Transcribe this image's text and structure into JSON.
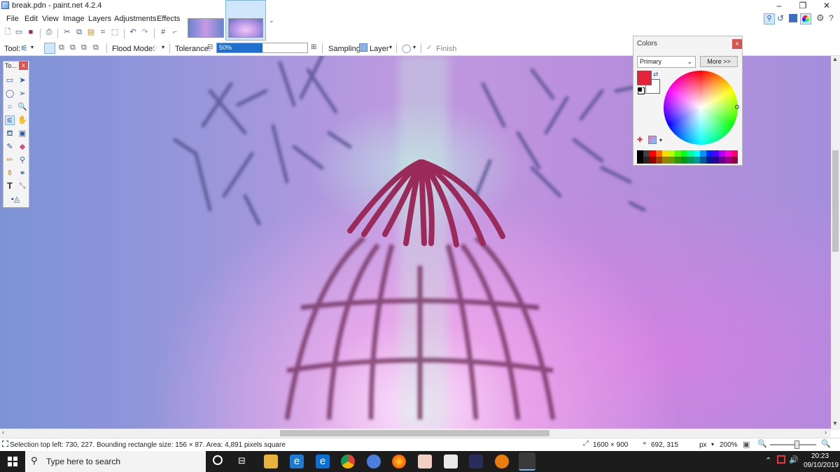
{
  "window": {
    "title": "break.pdn - paint.net 4.2.4",
    "min": "–",
    "max": "❐",
    "close": "✕"
  },
  "menu": [
    "File",
    "Edit",
    "View",
    "Image",
    "Layers",
    "Adjustments",
    "Effects"
  ],
  "toolbar2": {
    "tool_label": "Tool:",
    "flood_mode_label": "Flood Mode:",
    "tolerance_label": "Tolerance:",
    "tolerance_value": "50%",
    "tolerance_fraction": 0.5,
    "sampling_label": "Sampling:",
    "sampling_value": "Layer",
    "finish_label": "Finish"
  },
  "tools_window": {
    "title": "To...",
    "close": "x"
  },
  "colors_window": {
    "title": "Colors",
    "close": "x",
    "mode": "Primary",
    "more_button": "More >>",
    "primary_color": "#e8213a",
    "secondary_color": "#ffffff",
    "palette": [
      "#000000",
      "#404040",
      "#ff0000",
      "#ff6a00",
      "#ffd800",
      "#b6ff00",
      "#4cff00",
      "#00ff21",
      "#00ff90",
      "#00ffff",
      "#0094ff",
      "#0026ff",
      "#4800ff",
      "#b200ff",
      "#ff00dc",
      "#ff006e"
    ]
  },
  "status": {
    "selection_info": "Selection top left: 730, 227. Bounding rectangle size: 156 × 87. Area: 4,891 pixels square",
    "image_size": "1600 × 900",
    "cursor_pos": "692, 315",
    "units": "px",
    "zoom": "200%"
  },
  "taskbar": {
    "search_placeholder": "Type here to search",
    "time": "20:23",
    "date": "09/10/2019"
  }
}
